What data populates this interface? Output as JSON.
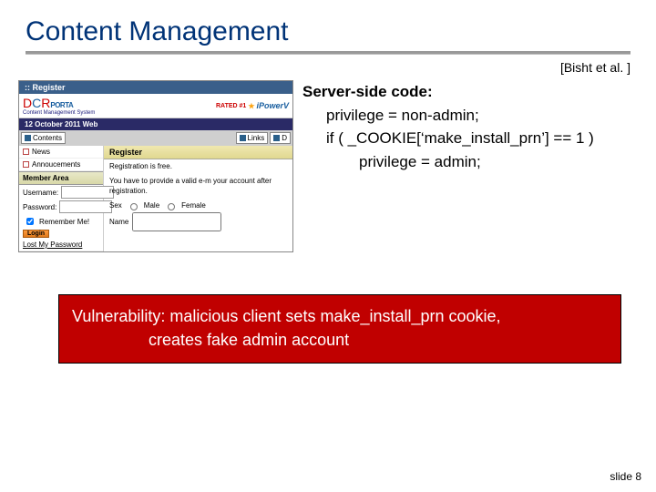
{
  "title": "Content Management",
  "citation": "[Bisht et al. ]",
  "screenshot": {
    "topbar": ":: Register",
    "logo_text": "DCR",
    "logo_sub": "PORTA",
    "logo_tag": "Content Management System",
    "rated": "RATED #1",
    "ipower": "iPowerV",
    "datebar": "12 October 2011 Web",
    "tab_contents": "Contents",
    "tab_links": "Links",
    "tab_d": "D",
    "left_items": [
      "News",
      "Annoucements"
    ],
    "member_area": "Member Area",
    "username_lbl": "Username:",
    "password_lbl": "Password:",
    "remember": "Remember Me!",
    "login_btn": "Login",
    "lost_pw": "Lost My Password",
    "reg_head": "Register",
    "reg_line1": "Registration is free.",
    "reg_line2": "You have to provide a valid e-m your account after registration.",
    "sex_lbl": "Sex",
    "male": "Male",
    "female": "Female",
    "name_lbl": "Name"
  },
  "code": {
    "heading": "Server-side code:",
    "l1": "privilege = non-admin;",
    "l2": "if ( _COOKIE[‘make_install_prn’] == 1 )",
    "l3": "privilege = admin;"
  },
  "vuln": {
    "l1": "Vulnerability: malicious client sets make_install_prn cookie,",
    "l2": "creates fake admin account"
  },
  "footer": "slide 8"
}
